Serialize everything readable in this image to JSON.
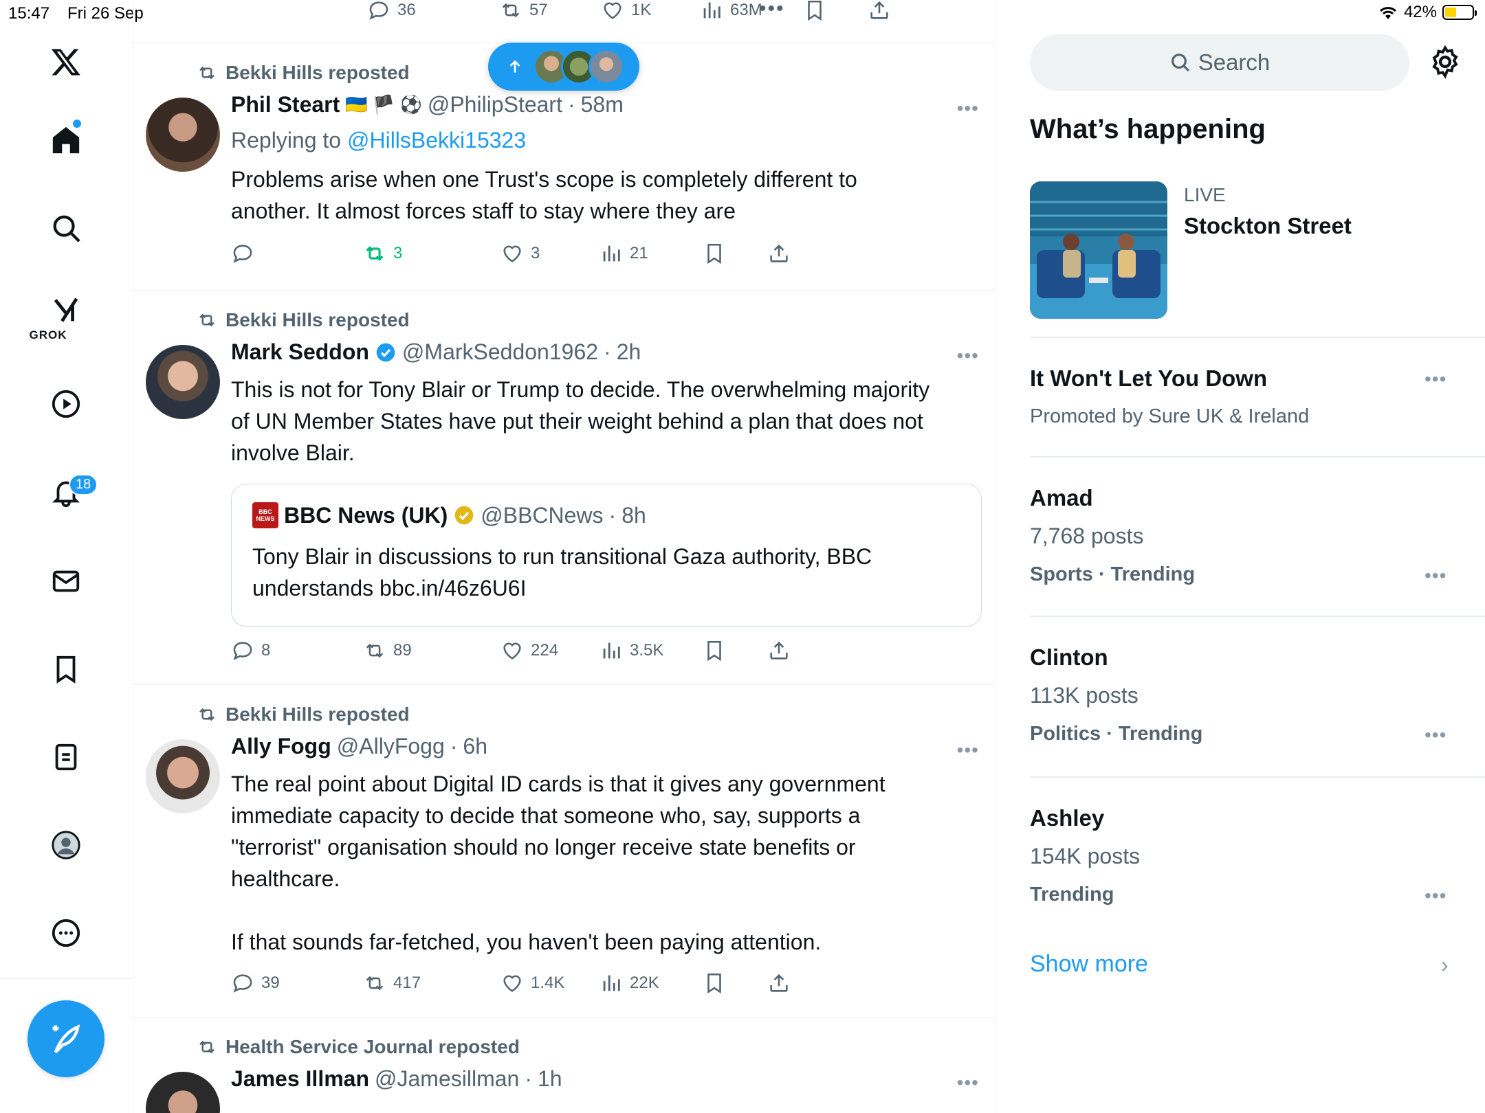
{
  "status": {
    "time": "15:47",
    "date": "Fri 26 Sep",
    "battery": "42%"
  },
  "nav": {
    "grok_label": "GROK",
    "notifications_count": "18"
  },
  "top_actions": {
    "replies": "36",
    "reposts": "57",
    "likes": "1K",
    "views": "63M"
  },
  "posts": [
    {
      "reposted_by": "Bekki Hills reposted",
      "name": "Phil Steart",
      "flags": "🇺🇦 🏴 ⚽",
      "handle": "@PhilipSteart",
      "time": "58m",
      "replying_label": "Replying to",
      "replying_to": "@HillsBekki15323",
      "text": "Problems arise when one Trust's scope is completely different to\nanother. It almost  forces staff to stay where they are",
      "replies": "",
      "reposts": "3",
      "likes": "3",
      "views": "21"
    },
    {
      "reposted_by": "Bekki Hills reposted",
      "name": "Mark Seddon",
      "handle": "@MarkSeddon1962",
      "time": "2h",
      "text": "This is not for Tony Blair or Trump to decide. The overwhelming majority\nof UN Member States have put their weight behind a plan that does not\ninvolve Blair.",
      "quote": {
        "logo": "BBC NEWS",
        "name": "BBC News (UK)",
        "handle": "@BBCNews",
        "time": "8h",
        "text": "Tony Blair in discussions to run transitional Gaza authority, BBC\nunderstands bbc.in/46z6U6I"
      },
      "replies": "8",
      "reposts": "89",
      "likes": "224",
      "views": "3.5K"
    },
    {
      "reposted_by": "Bekki Hills reposted",
      "name": "Ally Fogg",
      "handle": "@AllyFogg",
      "time": "6h",
      "text": "The real point about Digital ID cards is that it gives any government\nimmediate capacity to decide that someone who, say, supports a\n\"terrorist\" organisation should no longer receive state benefits or\nhealthcare.\n\nIf that sounds far-fetched, you haven't been paying attention.",
      "replies": "39",
      "reposts": "417",
      "likes": "1.4K",
      "views": "22K"
    },
    {
      "reposted_by": "Health Service Journal reposted",
      "name": "James Illman",
      "handle": "@Jamesillman",
      "time": "1h"
    }
  ],
  "sidebar": {
    "search_placeholder": "Search",
    "whats_happening": "What’s happening",
    "live": {
      "tag": "LIVE",
      "title": "Stockton Street"
    },
    "promoted": {
      "title": "It Won't Let You Down",
      "sub": "Promoted by Sure UK & Ireland"
    },
    "trends": [
      {
        "title": "Amad",
        "posts": "7,768 posts",
        "category": "Sports · Trending"
      },
      {
        "title": "Clinton",
        "posts": "113K posts",
        "category": "Politics · Trending"
      },
      {
        "title": "Ashley",
        "posts": "154K posts",
        "category": "Trending"
      }
    ],
    "show_more": "Show more"
  },
  "colors": {
    "accent": "#1d9bf0",
    "muted": "#536471",
    "repost_green": "#00ba7c"
  }
}
